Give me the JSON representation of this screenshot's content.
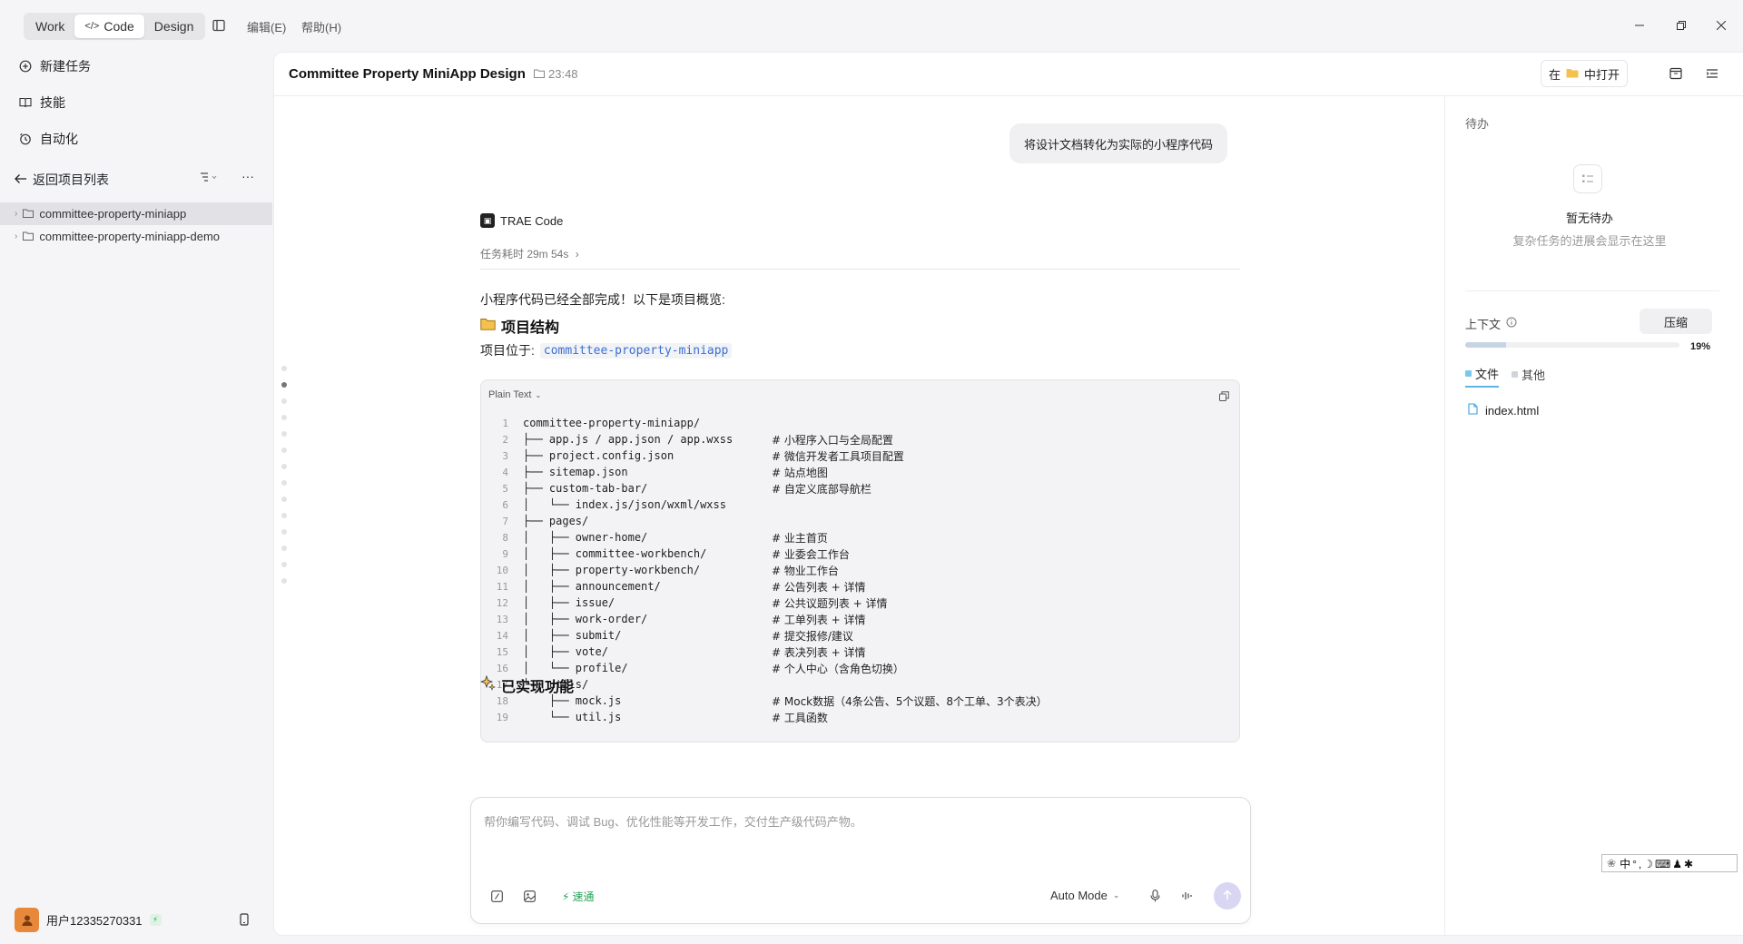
{
  "titlebar": {
    "modes": [
      "Work",
      "Code",
      "Design"
    ],
    "active_mode": "Code",
    "menu_edit": "编辑(E)",
    "menu_help": "帮助(H)"
  },
  "sidebar": {
    "new_task": "新建任务",
    "skills": "技能",
    "automation": "自动化",
    "back_to_projects": "返回项目列表",
    "projects": [
      "committee-property-miniapp",
      "committee-property-miniapp-demo"
    ],
    "user_name": "用户12335270331"
  },
  "header": {
    "title": "Committee Property MiniApp Design",
    "time": "23:48",
    "open_in_prefix": "在",
    "open_in_suffix": "中打开"
  },
  "chat": {
    "user_message": "将设计文档转化为实际的小程序代码",
    "agent_name": "TRAE Code",
    "duration": "任务耗时 29m 54s",
    "summary": "小程序代码已经全部完成！以下是项目概览:",
    "section_structure": "项目结构",
    "location_label": "项目位于:",
    "location_code": "committee-property-miniapp",
    "code_lang": "Plain Text",
    "code_lines": [
      {
        "code": "committee-property-miniapp/",
        "comment": ""
      },
      {
        "code": "├── app.js / app.json / app.wxss",
        "comment": "# 小程序入口与全局配置"
      },
      {
        "code": "├── project.config.json",
        "comment": "# 微信开发者工具项目配置"
      },
      {
        "code": "├── sitemap.json",
        "comment": "# 站点地图"
      },
      {
        "code": "├── custom-tab-bar/",
        "comment": "# 自定义底部导航栏"
      },
      {
        "code": "│   └── index.js/json/wxml/wxss",
        "comment": ""
      },
      {
        "code": "├── pages/",
        "comment": ""
      },
      {
        "code": "│   ├── owner-home/",
        "comment": "# 业主首页"
      },
      {
        "code": "│   ├── committee-workbench/",
        "comment": "# 业委会工作台"
      },
      {
        "code": "│   ├── property-workbench/",
        "comment": "# 物业工作台"
      },
      {
        "code": "│   ├── announcement/",
        "comment": "# 公告列表 + 详情"
      },
      {
        "code": "│   ├── issue/",
        "comment": "# 公共议题列表 + 详情"
      },
      {
        "code": "│   ├── work-order/",
        "comment": "# 工单列表 + 详情"
      },
      {
        "code": "│   ├── submit/",
        "comment": "# 提交报修/建议"
      },
      {
        "code": "│   ├── vote/",
        "comment": "# 表决列表 + 详情"
      },
      {
        "code": "│   └── profile/",
        "comment": "# 个人中心（含角色切换）"
      },
      {
        "code": "└── utils/",
        "comment": ""
      },
      {
        "code": "    ├── mock.js",
        "comment": "# Mock数据（4条公告、5个议题、8个工单、3个表决）"
      },
      {
        "code": "    └── util.js",
        "comment": "# 工具函数"
      }
    ],
    "section_features": "已实现功能"
  },
  "input": {
    "placeholder": "帮你编写代码、调试 Bug、优化性能等开发工作，交付生产级代码产物。",
    "speed_label": "速通",
    "mode_label": "Auto Mode"
  },
  "right_panel": {
    "todo_title": "待办",
    "todo_empty": "暂无待办",
    "todo_hint": "复杂任务的进展会显示在这里",
    "context_label": "上下文",
    "compress_label": "压缩",
    "context_percent_text": "19%",
    "context_fraction": 0.19,
    "tab_files": "文件",
    "tab_other": "其他",
    "files": [
      "index.html"
    ]
  },
  "ime": {
    "text": "中°,☽⌨♟✱"
  }
}
